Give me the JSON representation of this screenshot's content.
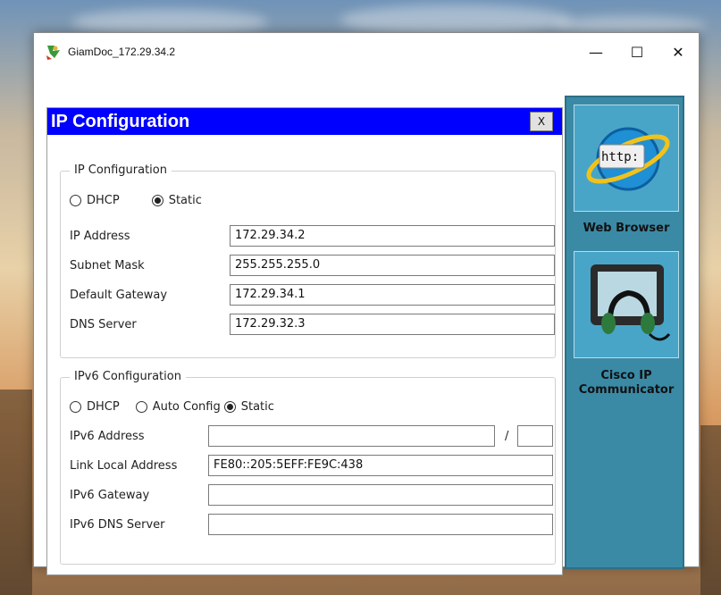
{
  "window": {
    "title": "GiamDoc_172.29.34.2",
    "controls": {
      "minimize": "—",
      "maximize": "☐",
      "close": "✕"
    }
  },
  "dialog": {
    "title": "IP Configuration",
    "close_label": "X",
    "ipv4": {
      "group_title": "IP Configuration",
      "dhcp_label": "DHCP",
      "static_label": "Static",
      "mode": "static",
      "fields": [
        {
          "label": "IP Address",
          "value": "172.29.34.2"
        },
        {
          "label": "Subnet Mask",
          "value": "255.255.255.0"
        },
        {
          "label": "Default Gateway",
          "value": "172.29.34.1"
        },
        {
          "label": "DNS Server",
          "value": "172.29.32.3"
        }
      ]
    },
    "ipv6": {
      "group_title": "IPv6 Configuration",
      "dhcp_label": "DHCP",
      "auto_label": "Auto Config",
      "static_label": "Static",
      "mode": "static",
      "address_label": "IPv6 Address",
      "address_value": "",
      "prefix_separator": "/",
      "prefix_value": "",
      "link_local_label": "Link Local Address",
      "link_local_value": "FE80::205:5EFF:FE9C:438",
      "gateway_label": "IPv6 Gateway",
      "gateway_value": "",
      "dns_label": "IPv6 DNS Server",
      "dns_value": ""
    }
  },
  "apps": [
    {
      "label": "Web Browser",
      "icon": "web-browser-icon",
      "icon_text": "http:"
    },
    {
      "label": "Cisco IP Communicator",
      "icon": "ip-communicator-icon"
    }
  ],
  "colors": {
    "dialog_title_bg": "#0000ff",
    "app_panel_bg": "#3a8aa6"
  }
}
